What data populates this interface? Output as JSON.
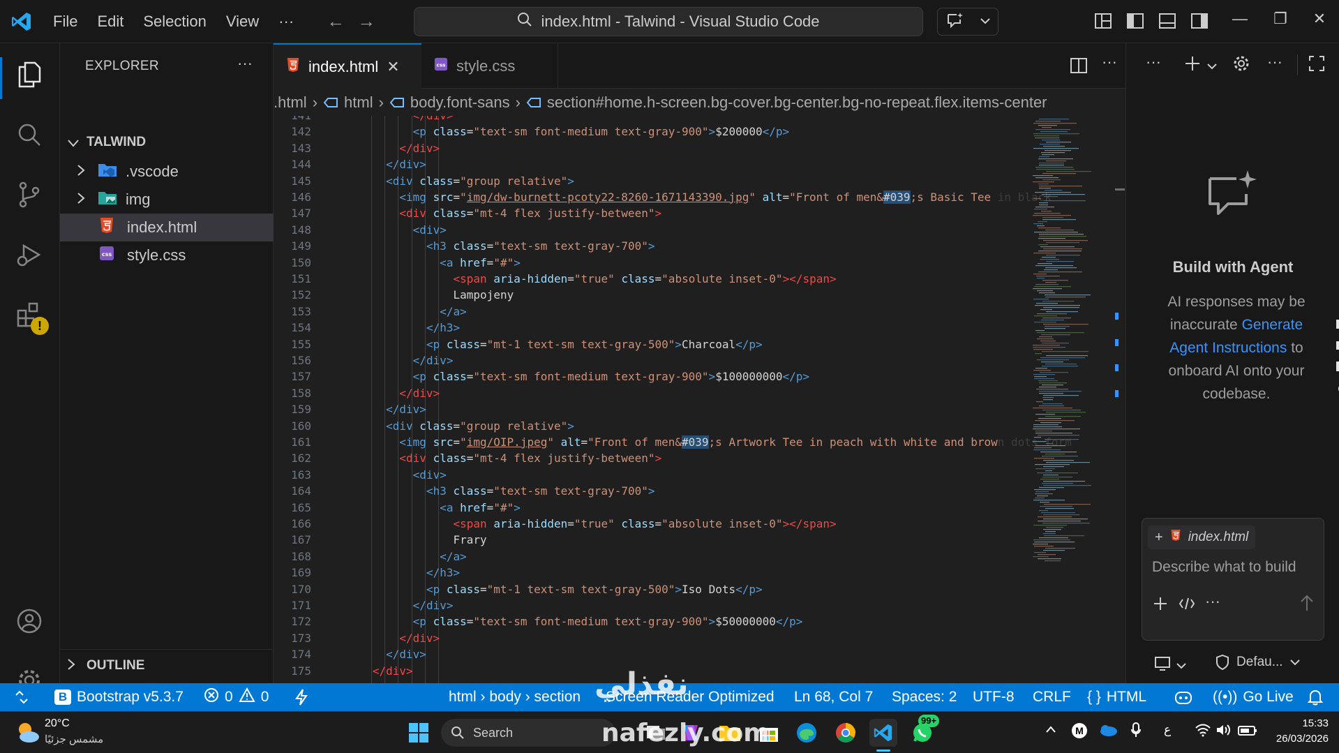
{
  "titlebar": {
    "menus": [
      "File",
      "Edit",
      "Selection",
      "View",
      "···"
    ],
    "command_center": "index.html - Talwind - Visual Studio Code"
  },
  "explorer": {
    "title": "EXPLORER",
    "more": "···",
    "root": "TALWIND",
    "items": [
      ".vscode",
      "img",
      "index.html",
      "style.css"
    ],
    "outline": "OUTLINE"
  },
  "tabs": [
    {
      "label": "index.html",
      "close": "✕"
    },
    {
      "label": "style.css"
    }
  ],
  "breadcrumb": [
    ".html",
    "html",
    "body.font-sans",
    "section#home.h-screen.bg-cover.bg-center.bg-no-repeat.flex.items-center"
  ],
  "editor": {
    "lines": [
      {
        "n": "141",
        "ind": 12,
        "parts": [
          [
            "t-err",
            "</div>"
          ]
        ]
      },
      {
        "n": "142",
        "ind": 12,
        "parts": [
          [
            "t-tag",
            "<p "
          ],
          [
            "t-attr",
            "class"
          ],
          [
            "t-txt",
            "="
          ],
          [
            "t-str",
            "\"text-sm font-medium text-gray-900\""
          ],
          [
            "t-tag",
            ">"
          ],
          [
            "t-txt",
            "$200000"
          ],
          [
            "t-tag",
            "</p>"
          ]
        ]
      },
      {
        "n": "143",
        "ind": 10,
        "parts": [
          [
            "t-err",
            "</div>"
          ]
        ]
      },
      {
        "n": "144",
        "ind": 8,
        "parts": [
          [
            "t-tag",
            "</div>"
          ]
        ]
      },
      {
        "n": "145",
        "ind": 8,
        "parts": [
          [
            "t-tag",
            "<div "
          ],
          [
            "t-attr",
            "class"
          ],
          [
            "t-txt",
            "="
          ],
          [
            "t-str",
            "\"group relative\""
          ],
          [
            "t-tag",
            ">"
          ]
        ]
      },
      {
        "n": "146",
        "ind": 10,
        "parts": [
          [
            "t-tag",
            "<img "
          ],
          [
            "t-attr",
            "src"
          ],
          [
            "t-txt",
            "="
          ],
          [
            "t-str",
            "\""
          ],
          [
            "t-str t-ul",
            "img/dw-burnett-pcoty22-8260-1671143390.jpg"
          ],
          [
            "t-str",
            "\" "
          ],
          [
            "t-attr",
            "alt"
          ],
          [
            "t-txt",
            "="
          ],
          [
            "t-str",
            "\"Front of men&"
          ],
          [
            "t-hl",
            "#039"
          ],
          [
            "t-str",
            ";s Basic Tee"
          ],
          [
            "t-fade",
            " in black"
          ]
        ]
      },
      {
        "n": "147",
        "ind": 10,
        "parts": [
          [
            "t-err",
            "<div "
          ],
          [
            "t-attr",
            "class"
          ],
          [
            "t-txt",
            "="
          ],
          [
            "t-str",
            "\"mt-4 flex justify-between\""
          ],
          [
            "t-err",
            ">"
          ]
        ]
      },
      {
        "n": "148",
        "ind": 12,
        "parts": [
          [
            "t-tag",
            "<div>"
          ]
        ]
      },
      {
        "n": "149",
        "ind": 14,
        "parts": [
          [
            "t-tag",
            "<h3 "
          ],
          [
            "t-attr",
            "class"
          ],
          [
            "t-txt",
            "="
          ],
          [
            "t-str",
            "\"text-sm text-gray-700\""
          ],
          [
            "t-tag",
            ">"
          ]
        ]
      },
      {
        "n": "150",
        "ind": 16,
        "parts": [
          [
            "t-tag",
            "<a "
          ],
          [
            "t-attr",
            "href"
          ],
          [
            "t-txt",
            "="
          ],
          [
            "t-str",
            "\"#\""
          ],
          [
            "t-tag",
            ">"
          ]
        ]
      },
      {
        "n": "151",
        "ind": 18,
        "parts": [
          [
            "t-err",
            "<span "
          ],
          [
            "t-attr",
            "aria-hidden"
          ],
          [
            "t-txt",
            "="
          ],
          [
            "t-str",
            "\"true\" "
          ],
          [
            "t-attr",
            "class"
          ],
          [
            "t-txt",
            "="
          ],
          [
            "t-str",
            "\"absolute inset-0\""
          ],
          [
            "t-err",
            "></span>"
          ]
        ]
      },
      {
        "n": "152",
        "ind": 18,
        "parts": [
          [
            "t-txt",
            "Lampojeny"
          ]
        ]
      },
      {
        "n": "153",
        "ind": 16,
        "parts": [
          [
            "t-tag",
            "</a>"
          ]
        ]
      },
      {
        "n": "154",
        "ind": 14,
        "parts": [
          [
            "t-tag",
            "</h3>"
          ]
        ]
      },
      {
        "n": "155",
        "ind": 14,
        "parts": [
          [
            "t-tag",
            "<p "
          ],
          [
            "t-attr",
            "class"
          ],
          [
            "t-txt",
            "="
          ],
          [
            "t-str",
            "\"mt-1 text-sm text-gray-500\""
          ],
          [
            "t-tag",
            ">"
          ],
          [
            "t-txt",
            "Charcoal"
          ],
          [
            "t-tag",
            "</p>"
          ]
        ]
      },
      {
        "n": "156",
        "ind": 12,
        "parts": [
          [
            "t-tag",
            "</div>"
          ]
        ]
      },
      {
        "n": "157",
        "ind": 12,
        "parts": [
          [
            "t-tag",
            "<p "
          ],
          [
            "t-attr",
            "class"
          ],
          [
            "t-txt",
            "="
          ],
          [
            "t-str",
            "\"text-sm font-medium text-gray-900\""
          ],
          [
            "t-tag",
            ">"
          ],
          [
            "t-txt",
            "$100000000"
          ],
          [
            "t-tag",
            "</p>"
          ]
        ]
      },
      {
        "n": "158",
        "ind": 10,
        "parts": [
          [
            "t-err",
            "</div>"
          ]
        ]
      },
      {
        "n": "159",
        "ind": 8,
        "parts": [
          [
            "t-tag",
            "</div>"
          ]
        ]
      },
      {
        "n": "160",
        "ind": 8,
        "parts": [
          [
            "t-tag",
            "<div "
          ],
          [
            "t-attr",
            "class"
          ],
          [
            "t-txt",
            "="
          ],
          [
            "t-str",
            "\"group relative\""
          ],
          [
            "t-tag",
            ">"
          ]
        ]
      },
      {
        "n": "161",
        "ind": 10,
        "parts": [
          [
            "t-tag",
            "<img "
          ],
          [
            "t-attr",
            "src"
          ],
          [
            "t-txt",
            "="
          ],
          [
            "t-str",
            "\""
          ],
          [
            "t-str t-ul",
            "img/OIP.jpeg"
          ],
          [
            "t-str",
            "\" "
          ],
          [
            "t-attr",
            "alt"
          ],
          [
            "t-txt",
            "="
          ],
          [
            "t-str",
            "\"Front of men&"
          ],
          [
            "t-hl",
            "#039"
          ],
          [
            "t-str",
            ";s Artwork Tee in peach with white and brow"
          ],
          [
            "t-fade",
            "n dots form"
          ]
        ]
      },
      {
        "n": "162",
        "ind": 10,
        "parts": [
          [
            "t-err",
            "<div "
          ],
          [
            "t-attr",
            "class"
          ],
          [
            "t-txt",
            "="
          ],
          [
            "t-str",
            "\"mt-4 flex justify-between\""
          ],
          [
            "t-err",
            ">"
          ]
        ]
      },
      {
        "n": "163",
        "ind": 12,
        "parts": [
          [
            "t-tag",
            "<div>"
          ]
        ]
      },
      {
        "n": "164",
        "ind": 14,
        "parts": [
          [
            "t-tag",
            "<h3 "
          ],
          [
            "t-attr",
            "class"
          ],
          [
            "t-txt",
            "="
          ],
          [
            "t-str",
            "\"text-sm text-gray-700\""
          ],
          [
            "t-tag",
            ">"
          ]
        ]
      },
      {
        "n": "165",
        "ind": 16,
        "parts": [
          [
            "t-tag",
            "<a "
          ],
          [
            "t-attr",
            "href"
          ],
          [
            "t-txt",
            "="
          ],
          [
            "t-str",
            "\"#\""
          ],
          [
            "t-tag",
            ">"
          ]
        ]
      },
      {
        "n": "166",
        "ind": 18,
        "parts": [
          [
            "t-err",
            "<span "
          ],
          [
            "t-attr",
            "aria-hidden"
          ],
          [
            "t-txt",
            "="
          ],
          [
            "t-str",
            "\"true\" "
          ],
          [
            "t-attr",
            "class"
          ],
          [
            "t-txt",
            "="
          ],
          [
            "t-str",
            "\"absolute inset-0\""
          ],
          [
            "t-err",
            "></span>"
          ]
        ]
      },
      {
        "n": "167",
        "ind": 18,
        "parts": [
          [
            "t-txt",
            "Frary"
          ]
        ]
      },
      {
        "n": "168",
        "ind": 16,
        "parts": [
          [
            "t-tag",
            "</a>"
          ]
        ]
      },
      {
        "n": "169",
        "ind": 14,
        "parts": [
          [
            "t-tag",
            "</h3>"
          ]
        ]
      },
      {
        "n": "170",
        "ind": 14,
        "parts": [
          [
            "t-tag",
            "<p "
          ],
          [
            "t-attr",
            "class"
          ],
          [
            "t-txt",
            "="
          ],
          [
            "t-str",
            "\"mt-1 text-sm text-gray-500\""
          ],
          [
            "t-tag",
            ">"
          ],
          [
            "t-txt",
            "Iso Dots"
          ],
          [
            "t-tag",
            "</p>"
          ]
        ]
      },
      {
        "n": "171",
        "ind": 12,
        "parts": [
          [
            "t-tag",
            "</div>"
          ]
        ]
      },
      {
        "n": "172",
        "ind": 12,
        "parts": [
          [
            "t-tag",
            "<p "
          ],
          [
            "t-attr",
            "class"
          ],
          [
            "t-txt",
            "="
          ],
          [
            "t-str",
            "\"text-sm font-medium text-gray-900\""
          ],
          [
            "t-tag",
            ">"
          ],
          [
            "t-txt",
            "$50000000"
          ],
          [
            "t-tag",
            "</p>"
          ]
        ]
      },
      {
        "n": "173",
        "ind": 10,
        "parts": [
          [
            "t-err",
            "</div>"
          ]
        ]
      },
      {
        "n": "174",
        "ind": 8,
        "parts": [
          [
            "t-tag",
            "</div>"
          ]
        ]
      },
      {
        "n": "175",
        "ind": 6,
        "parts": [
          [
            "t-err",
            "</div>"
          ]
        ]
      }
    ]
  },
  "chat": {
    "title": "Build with Agent",
    "desc_1": "AI responses may be inaccurate",
    "link": "Generate Agent Instructions",
    "desc_2": " to onboard AI onto your codebase.",
    "context_file": "index.html",
    "placeholder": "Describe what to build",
    "mode": "Defau..."
  },
  "statusbar": {
    "bootstrap": "Bootstrap v5.3.7",
    "errors": "0",
    "warnings": "0",
    "path": "html › body › section",
    "screen_reader": "Screen Reader Optimized",
    "position": "Ln 68, Col 7",
    "spaces": "Spaces: 2",
    "encoding": "UTF-8",
    "eol": "CRLF",
    "language": "HTML",
    "golive": "Go Live"
  },
  "taskbar": {
    "temp": "20°C",
    "weather": "مشمس جزئيًا",
    "search": "Search",
    "whatsapp_badge": "99+",
    "ime": "ع",
    "time": "15:33",
    "date": "26/03/2026"
  },
  "watermark": {
    "arabic": "نفذلي",
    "latin": "nafezly.com"
  },
  "colors": {
    "accent": "#0078d4",
    "statusbar": "#0078d4",
    "link": "#3794ff"
  }
}
